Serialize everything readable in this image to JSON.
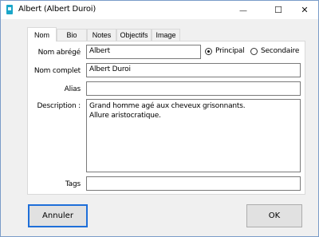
{
  "window": {
    "title": "Albert (Albert Duroi)",
    "min_symbol": "—",
    "max_symbol": "☐",
    "close_symbol": "✕"
  },
  "tabs": [
    {
      "label": "Nom",
      "active": true
    },
    {
      "label": "Bio",
      "active": false
    },
    {
      "label": "Notes",
      "active": false
    },
    {
      "label": "Objectifs",
      "active": false
    },
    {
      "label": "Image",
      "active": false
    }
  ],
  "form": {
    "short_name_label": "Nom abrégé",
    "short_name_value": "Albert",
    "full_name_label": "Nom complet",
    "full_name_value": "Albert Duroi",
    "alias_label": "Alias",
    "alias_value": "",
    "description_label": "Description :",
    "description_lines": [
      "Grand homme agé aux cheveux grisonnants.",
      "Allure aristocratique."
    ],
    "tags_label": "Tags",
    "tags_value": ""
  },
  "role": {
    "principal_label": "Principal",
    "secondaire_label": "Secondaire",
    "selected": "Principal"
  },
  "buttons": {
    "cancel_label": "Annuler",
    "ok_label": "OK"
  }
}
